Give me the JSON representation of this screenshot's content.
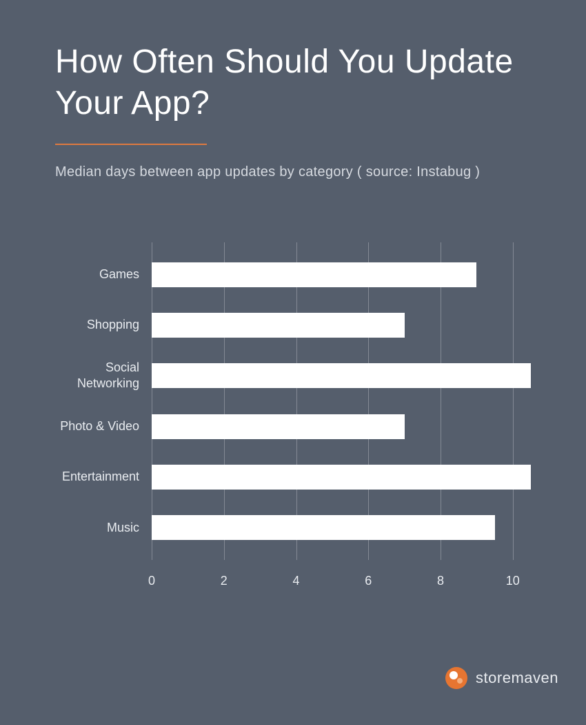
{
  "title": "How Often Should You Update Your App?",
  "subtitle": "Median days between app updates by category ( source: Instabug )",
  "brand": "storemaven",
  "chart_data": {
    "type": "bar",
    "orientation": "horizontal",
    "title": "Median days between app updates by category",
    "xlabel": "",
    "ylabel": "",
    "xlim": [
      0,
      10.5
    ],
    "xticks": [
      0,
      2,
      4,
      6,
      8,
      10
    ],
    "categories": [
      "Games",
      "Shopping",
      "Social Networking",
      "Photo & Video",
      "Entertainment",
      "Music"
    ],
    "values": [
      9.0,
      7.0,
      10.5,
      7.0,
      10.5,
      9.5
    ]
  }
}
